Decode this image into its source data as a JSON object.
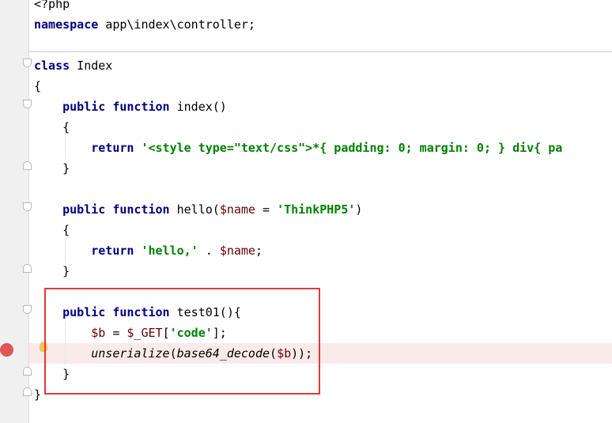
{
  "editor": {
    "language": "php",
    "lines": [
      {
        "tokens": [
          {
            "t": "<?php",
            "c": "plain"
          }
        ]
      },
      {
        "tokens": [
          {
            "t": "namespace",
            "c": "kw"
          },
          {
            "t": " app\\index\\controller;",
            "c": "plain"
          }
        ]
      },
      {
        "tokens": []
      },
      {
        "tokens": [
          {
            "t": "class",
            "c": "kw"
          },
          {
            "t": " Index",
            "c": "plain"
          }
        ]
      },
      {
        "tokens": [
          {
            "t": "{",
            "c": "plain"
          }
        ]
      },
      {
        "tokens": [
          {
            "t": "    public",
            "c": "kw"
          },
          {
            "t": " ",
            "c": "plain"
          },
          {
            "t": "function",
            "c": "kw"
          },
          {
            "t": " index()",
            "c": "plain"
          }
        ]
      },
      {
        "tokens": [
          {
            "t": "    {",
            "c": "plain"
          }
        ]
      },
      {
        "tokens": [
          {
            "t": "        return",
            "c": "kw"
          },
          {
            "t": " ",
            "c": "plain"
          },
          {
            "t": "'<style type=\"text/css\">*{ padding: 0; margin: 0; } div{ pa",
            "c": "str"
          }
        ]
      },
      {
        "tokens": [
          {
            "t": "    }",
            "c": "plain"
          }
        ]
      },
      {
        "tokens": []
      },
      {
        "tokens": [
          {
            "t": "    public",
            "c": "kw"
          },
          {
            "t": " ",
            "c": "plain"
          },
          {
            "t": "function",
            "c": "kw"
          },
          {
            "t": " hello(",
            "c": "plain"
          },
          {
            "t": "$name",
            "c": "var"
          },
          {
            "t": " = ",
            "c": "plain"
          },
          {
            "t": "'ThinkPHP5'",
            "c": "str"
          },
          {
            "t": ")",
            "c": "plain"
          }
        ]
      },
      {
        "tokens": [
          {
            "t": "    {",
            "c": "plain"
          }
        ]
      },
      {
        "tokens": [
          {
            "t": "        return",
            "c": "kw"
          },
          {
            "t": " ",
            "c": "plain"
          },
          {
            "t": "'hello,'",
            "c": "str"
          },
          {
            "t": " . ",
            "c": "plain"
          },
          {
            "t": "$name",
            "c": "var"
          },
          {
            "t": ";",
            "c": "plain"
          }
        ]
      },
      {
        "tokens": [
          {
            "t": "    }",
            "c": "plain"
          }
        ]
      },
      {
        "tokens": []
      },
      {
        "tokens": [
          {
            "t": "    public",
            "c": "kw"
          },
          {
            "t": " ",
            "c": "plain"
          },
          {
            "t": "function",
            "c": "kw"
          },
          {
            "t": " test01(){",
            "c": "plain"
          }
        ]
      },
      {
        "tokens": [
          {
            "t": "        ",
            "c": "plain"
          },
          {
            "t": "$b",
            "c": "var"
          },
          {
            "t": " = ",
            "c": "plain"
          },
          {
            "t": "$_GET",
            "c": "var"
          },
          {
            "t": "[",
            "c": "plain"
          },
          {
            "t": "'code'",
            "c": "str"
          },
          {
            "t": "];",
            "c": "plain"
          }
        ]
      },
      {
        "tokens": [
          {
            "t": "        ",
            "c": "plain"
          },
          {
            "t": "unserialize",
            "c": "ital"
          },
          {
            "t": "(",
            "c": "plain"
          },
          {
            "t": "base64_decode",
            "c": "ital"
          },
          {
            "t": "(",
            "c": "plain"
          },
          {
            "t": "$b",
            "c": "var"
          },
          {
            "t": "));",
            "c": "plain"
          }
        ]
      },
      {
        "tokens": [
          {
            "t": "    }",
            "c": "plain"
          }
        ]
      },
      {
        "tokens": [
          {
            "t": "}",
            "c": "plain"
          }
        ]
      }
    ],
    "breakpoint_line": 17,
    "intention_bulb_line": 17,
    "highlighted_line": 17,
    "folded_markers": "fold",
    "colors": {
      "keyword": "#000080",
      "string": "#008000",
      "variable": "#660000",
      "highlight": "#fbeaea",
      "breakpoint": "#e05555",
      "annotation_box": "#e53935"
    },
    "icons": [
      "breakpoint-icon",
      "intention-bulb-icon",
      "fold-toggle-icon"
    ]
  }
}
